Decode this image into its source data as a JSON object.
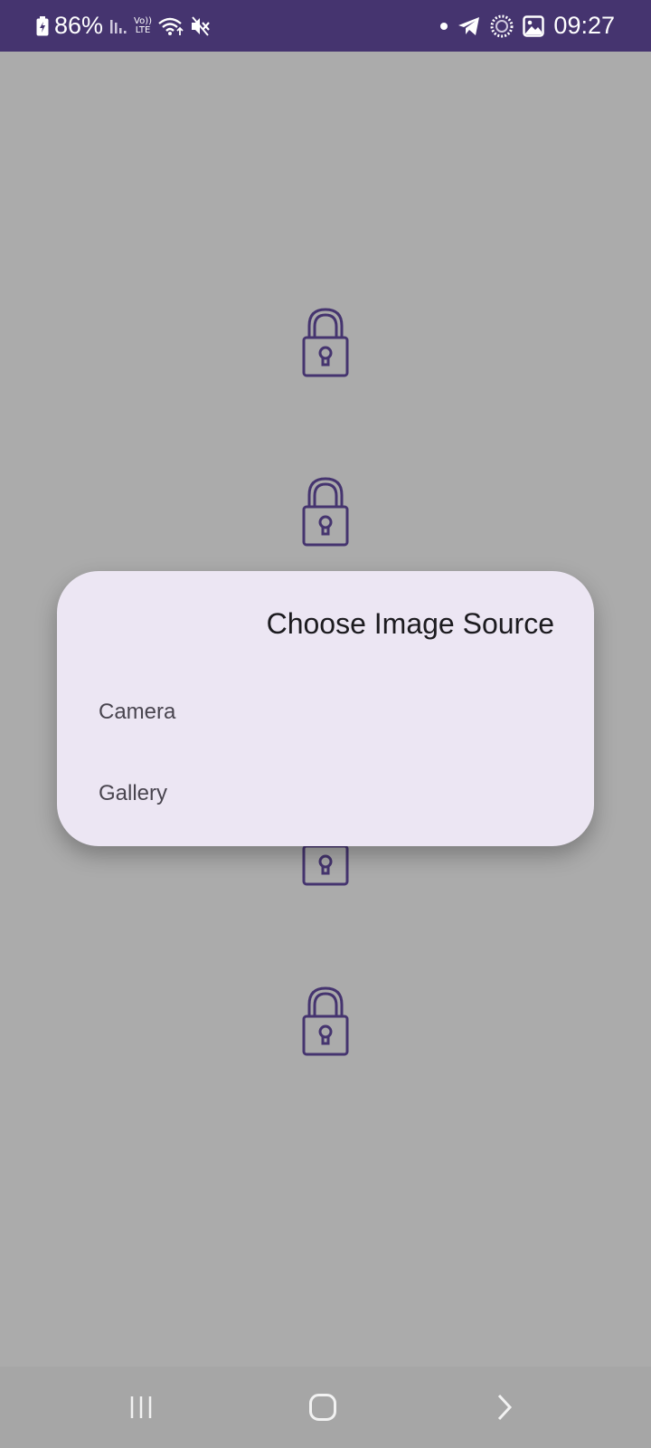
{
  "status_bar": {
    "battery": "86%",
    "volte_top": "Vo))",
    "volte_bottom": "LTE",
    "time": "09:27",
    "background": "#45346f"
  },
  "background_icons": [
    "lock-icon",
    "lock-icon",
    "lock-icon",
    "lock-icon"
  ],
  "dialog": {
    "title": "Choose Image Source",
    "options": [
      {
        "label": "Camera"
      },
      {
        "label": "Gallery"
      }
    ],
    "background": "#ece6f3"
  },
  "nav_bar": {
    "buttons": [
      "recent-apps-icon",
      "home-icon",
      "back-icon"
    ]
  },
  "colors": {
    "accent": "#45346f",
    "scrim": "#ababab"
  }
}
